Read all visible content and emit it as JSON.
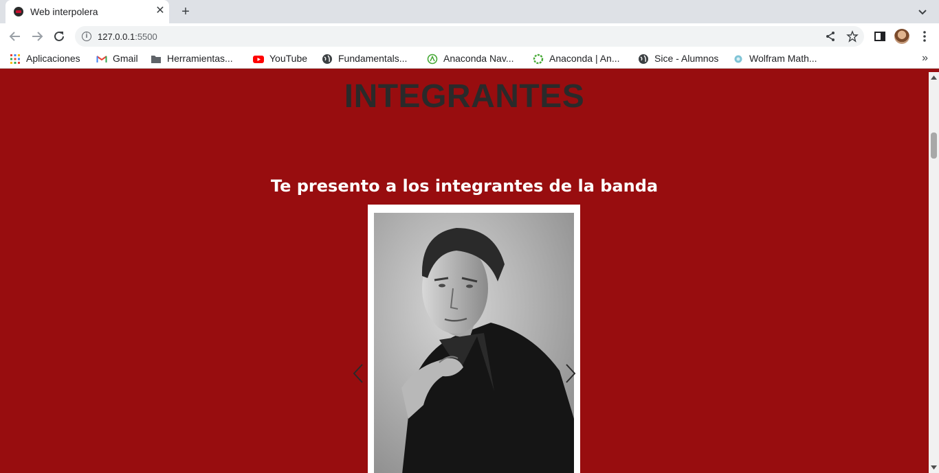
{
  "browser": {
    "tab_title": "Web interpolera",
    "url_host": "127.0.0.1",
    "url_port": ":5500"
  },
  "bookmarks": [
    {
      "label": "Aplicaciones",
      "icon": "apps-grid-icon"
    },
    {
      "label": "Gmail",
      "icon": "gmail-icon"
    },
    {
      "label": "Herramientas...",
      "icon": "folder-icon"
    },
    {
      "label": "YouTube",
      "icon": "youtube-icon"
    },
    {
      "label": "Fundamentals...",
      "icon": "globe-icon"
    },
    {
      "label": "Anaconda Nav...",
      "icon": "anaconda-icon"
    },
    {
      "label": "Anaconda | An...",
      "icon": "anaconda-ring-icon"
    },
    {
      "label": "Sice - Alumnos",
      "icon": "globe-icon"
    },
    {
      "label": "Wolfram Math...",
      "icon": "wolfram-icon"
    }
  ],
  "page": {
    "title": "INTEGRANTES",
    "subtitle": "Te presento a los integrantes de la banda"
  },
  "colors": {
    "page_background": "#980d0f",
    "title_text": "#2a2a2a",
    "subtitle_text": "#ffffff"
  }
}
